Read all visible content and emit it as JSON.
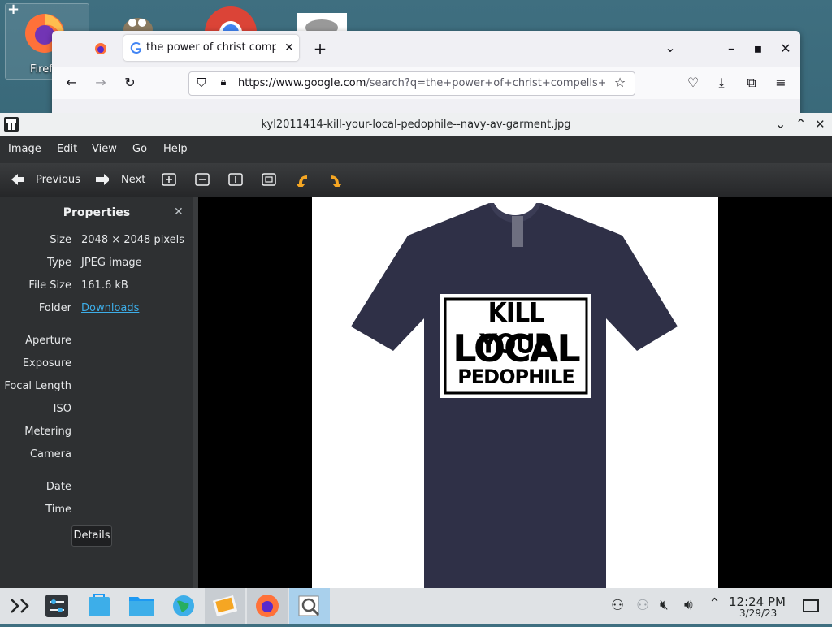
{
  "desktop": {
    "firefox_icon_label": "Firef",
    "add_glyph": "+"
  },
  "firefox": {
    "tab_title": "the power of christ compels",
    "url_domain": "https://www.google.com",
    "url_rest": "/search?q=the+power+of+christ+compells+y",
    "new_tab_glyph": "+"
  },
  "viewer": {
    "title": "kyl2011414-kill-your-local-pedophile--navy-av-garment.jpg",
    "menu": [
      "Image",
      "Edit",
      "View",
      "Go",
      "Help"
    ],
    "toolbar": {
      "previous": "Previous",
      "next": "Next"
    },
    "properties": {
      "title": "Properties",
      "rows": [
        {
          "label": "Size",
          "value": "2048 × 2048 pixels"
        },
        {
          "label": "Type",
          "value": "JPEG image"
        },
        {
          "label": "File Size",
          "value": "161.6 kB"
        },
        {
          "label": "Folder",
          "value": "Downloads"
        }
      ],
      "exif_labels": [
        "Aperture",
        "Exposure",
        "Focal Length",
        "ISO",
        "Metering",
        "Camera"
      ],
      "date_labels": [
        "Date",
        "Time"
      ],
      "details_button": "Details"
    },
    "shirt_text": [
      "KILL YOUR",
      "LOCAL",
      "PEDOPHILE"
    ]
  },
  "taskbar": {
    "time": "12:24 PM",
    "date": "3/29/23"
  }
}
